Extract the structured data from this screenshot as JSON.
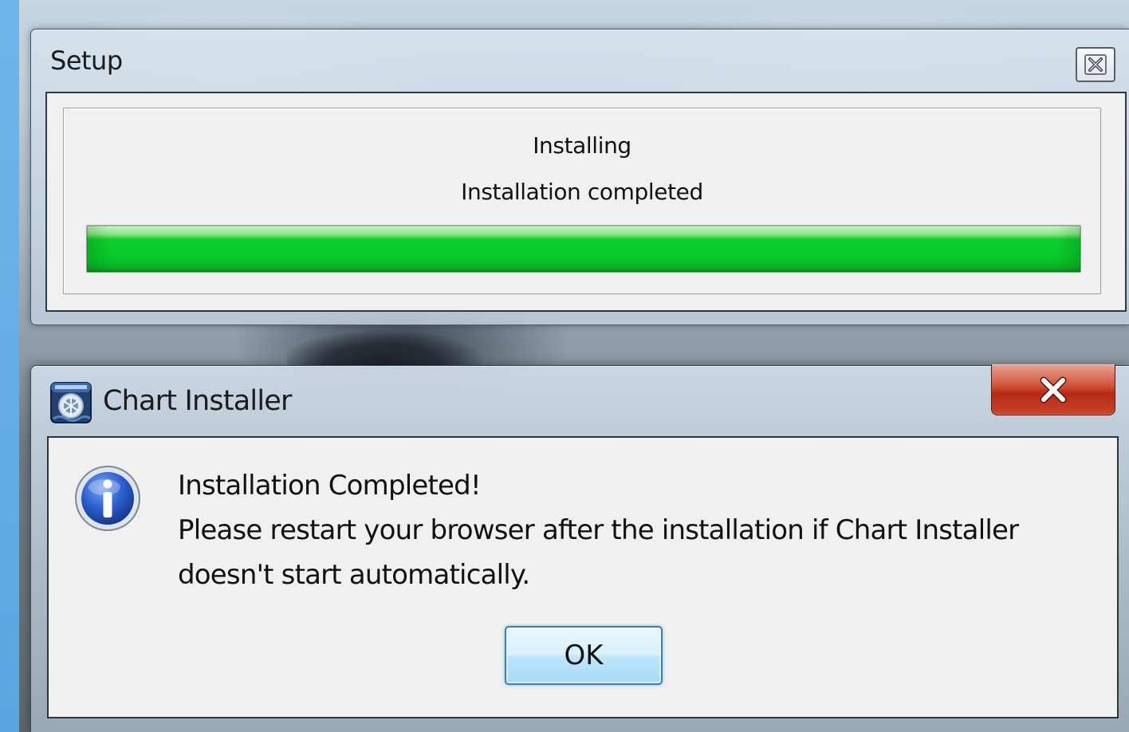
{
  "setup_window": {
    "title": "Setup",
    "close_icon": "close-x-icon",
    "status_heading": "Installing",
    "status_detail": "Installation completed",
    "progress": {
      "percent": 100,
      "color": "#06c82a"
    }
  },
  "chart_installer_dialog": {
    "title": "Chart Installer",
    "app_icon": "chart-installer-app-icon",
    "close_icon": "close-x-icon",
    "close_button_color": "#c8452d",
    "info_icon": "information-icon",
    "info_icon_color": "#1f4fbf",
    "message_lines": [
      "Installation Completed!",
      "Please restart your browser after the installation if Chart Installer",
      "doesn't start automatically."
    ],
    "ok_label": "OK"
  }
}
